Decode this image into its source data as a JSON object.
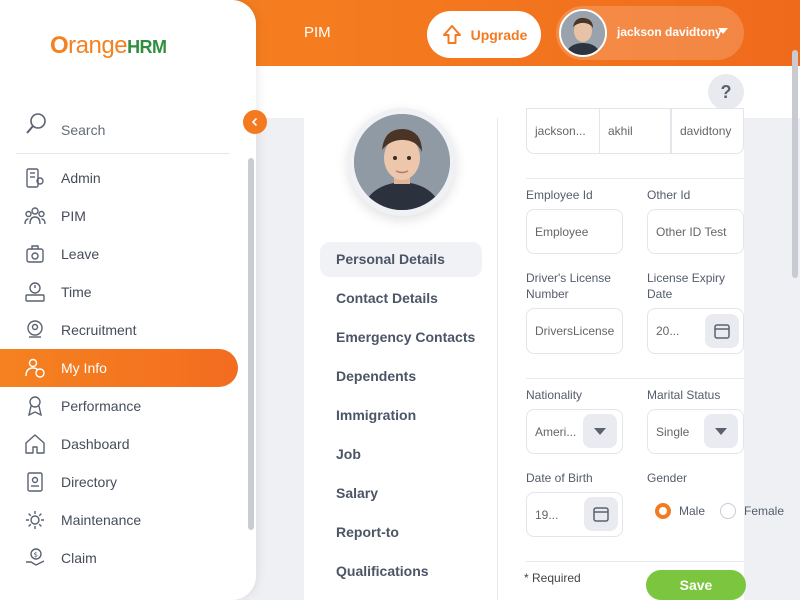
{
  "header": {
    "module": "PIM",
    "upgrade_label": "Upgrade",
    "username": "jackson davidtony",
    "help_label": "?"
  },
  "brand": {
    "logo_o": "O",
    "logo_range": "range",
    "logo_hrm": "HRM"
  },
  "sidebar": {
    "search_label": "Search",
    "items": [
      {
        "label": "Admin",
        "icon": "admin-icon"
      },
      {
        "label": "PIM",
        "icon": "pim-icon"
      },
      {
        "label": "Leave",
        "icon": "leave-icon"
      },
      {
        "label": "Time",
        "icon": "time-icon"
      },
      {
        "label": "Recruitment",
        "icon": "recruitment-icon"
      },
      {
        "label": "My Info",
        "icon": "myinfo-icon",
        "active": true
      },
      {
        "label": "Performance",
        "icon": "performance-icon"
      },
      {
        "label": "Dashboard",
        "icon": "dashboard-icon"
      },
      {
        "label": "Directory",
        "icon": "directory-icon"
      },
      {
        "label": "Maintenance",
        "icon": "maintenance-icon"
      },
      {
        "label": "Claim",
        "icon": "claim-icon"
      }
    ]
  },
  "tabs": [
    {
      "label": "Personal Details",
      "active": true
    },
    {
      "label": "Contact Details"
    },
    {
      "label": "Emergency Contacts"
    },
    {
      "label": "Dependents"
    },
    {
      "label": "Immigration"
    },
    {
      "label": "Job"
    },
    {
      "label": "Salary"
    },
    {
      "label": "Report-to"
    },
    {
      "label": "Qualifications"
    }
  ],
  "form": {
    "first_name": "jackson...",
    "middle_name": "akhil",
    "last_name": "davidtony",
    "employee_id_label": "Employee Id",
    "employee_id_value": "Employee",
    "other_id_label": "Other Id",
    "other_id_value": "Other ID Test",
    "license_label_1": "Driver's License",
    "license_label_2": "Number",
    "license_value": "DriversLicense",
    "expiry_label_1": "License Expiry",
    "expiry_label_2": "Date",
    "expiry_value": "20...",
    "nationality_label": "Nationality",
    "nationality_value": "Ameri...",
    "marital_label": "Marital Status",
    "marital_value": "Single",
    "dob_label": "Date of Birth",
    "dob_value": "19...",
    "gender_label": "Gender",
    "gender_male": "Male",
    "gender_female": "Female",
    "gender_selected": "Male",
    "required_note": "* Required",
    "save_label": "Save"
  },
  "colors": {
    "accent": "#f47a20",
    "save": "#7cc53f"
  }
}
